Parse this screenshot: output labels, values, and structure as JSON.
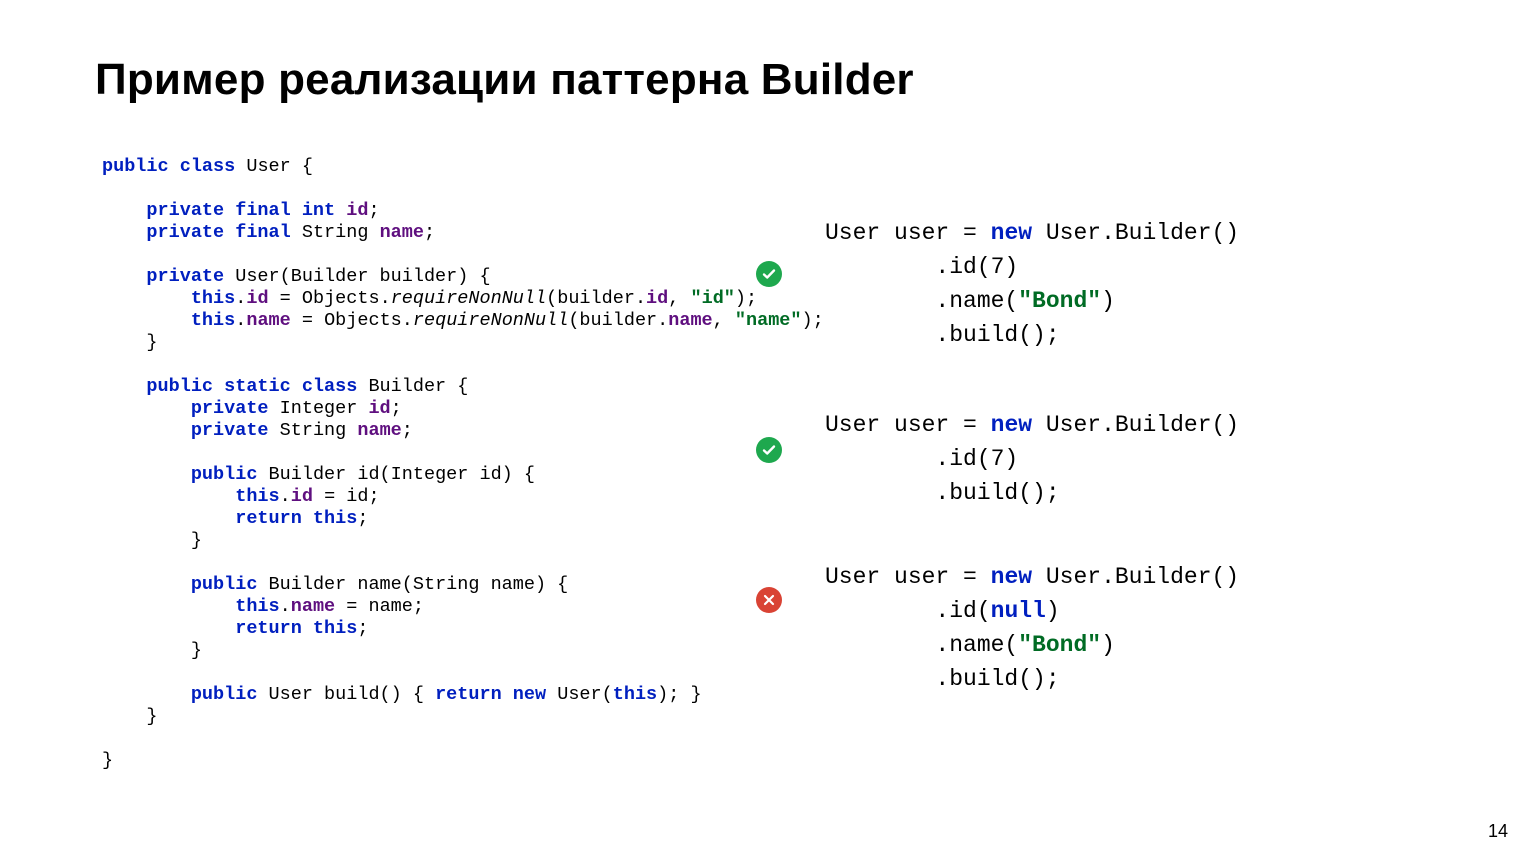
{
  "title": "Пример реализации паттерна Builder",
  "page_number": "14",
  "left_code": {
    "l01a": "public class",
    "l01b": " User {",
    "blank": "",
    "l02a": "    private final int ",
    "l02id": "id",
    "l02b": ";",
    "l03a": "    private final",
    "l03b": " String ",
    "l03name": "name",
    "l03c": ";",
    "l04a": "    private",
    "l04b": " User(Builder builder) {",
    "l05a": "        this",
    "l05b": ".",
    "l05id": "id",
    "l05c": " = Objects.",
    "l05m": "requireNonNull",
    "l05d": "(builder.",
    "l05id2": "id",
    "l05e": ", ",
    "l05s": "\"id\"",
    "l05f": ");",
    "l06a": "        this",
    "l06b": ".",
    "l06n": "name",
    "l06c": " = Objects.",
    "l06m": "requireNonNull",
    "l06d": "(builder.",
    "l06n2": "name",
    "l06e": ", ",
    "l06s": "\"name\"",
    "l06f": ");",
    "l07": "    }",
    "l08a": "    public static class",
    "l08b": " Builder {",
    "l09a": "        private",
    "l09b": " Integer ",
    "l09id": "id",
    "l09c": ";",
    "l10a": "        private",
    "l10b": " String ",
    "l10n": "name",
    "l10c": ";",
    "l11a": "        public",
    "l11b": " Builder id(Integer id) {",
    "l12a": "            this",
    "l12b": ".",
    "l12id": "id",
    "l12c": " = id;",
    "l13a": "            return this",
    "l13b": ";",
    "l14": "        }",
    "l15a": "        public",
    "l15b": " Builder name(String name) {",
    "l16a": "            this",
    "l16b": ".",
    "l16n": "name",
    "l16c": " = name;",
    "l17a": "            return this",
    "l17b": ";",
    "l18": "        }",
    "l19a": "        public",
    "l19b": " User build() { ",
    "l19c": "return new",
    "l19d": " User(",
    "l19e": "this",
    "l19f": "); }",
    "l20": "    }",
    "l21": "}"
  },
  "ex1": {
    "a": "User user = ",
    "new": "new",
    "b": " User.Builder()",
    "c": "        .id(7)",
    "d1": "        .name(",
    "d2": "\"Bond\"",
    "d3": ")",
    "e": "        .build();"
  },
  "ex2": {
    "a": "User user = ",
    "new": "new",
    "b": " User.Builder()",
    "c": "        .id(7)",
    "e": "        .build();"
  },
  "ex3": {
    "a": "User user = ",
    "new": "new",
    "b": " User.Builder()",
    "c1": "        .id(",
    "c2": "null",
    "c3": ")",
    "d1": "        .name(",
    "d2": "\"Bond\"",
    "d3": ")",
    "e": "        .build();"
  },
  "badges": {
    "b1": "check",
    "b2": "check",
    "b3": "cross"
  }
}
